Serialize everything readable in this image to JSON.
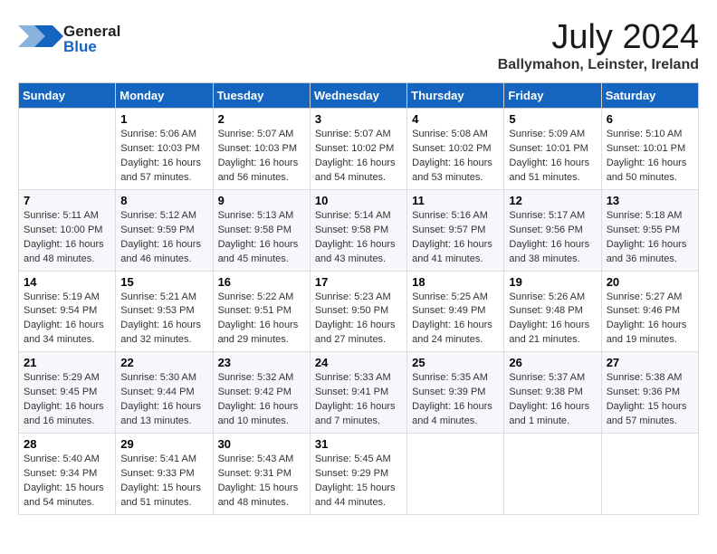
{
  "logo": {
    "general": "General",
    "blue": "Blue"
  },
  "title": "July 2024",
  "subtitle": "Ballymahon, Leinster, Ireland",
  "headers": [
    "Sunday",
    "Monday",
    "Tuesday",
    "Wednesday",
    "Thursday",
    "Friday",
    "Saturday"
  ],
  "weeks": [
    [
      {
        "day": "",
        "info": ""
      },
      {
        "day": "1",
        "info": "Sunrise: 5:06 AM\nSunset: 10:03 PM\nDaylight: 16 hours\nand 57 minutes."
      },
      {
        "day": "2",
        "info": "Sunrise: 5:07 AM\nSunset: 10:03 PM\nDaylight: 16 hours\nand 56 minutes."
      },
      {
        "day": "3",
        "info": "Sunrise: 5:07 AM\nSunset: 10:02 PM\nDaylight: 16 hours\nand 54 minutes."
      },
      {
        "day": "4",
        "info": "Sunrise: 5:08 AM\nSunset: 10:02 PM\nDaylight: 16 hours\nand 53 minutes."
      },
      {
        "day": "5",
        "info": "Sunrise: 5:09 AM\nSunset: 10:01 PM\nDaylight: 16 hours\nand 51 minutes."
      },
      {
        "day": "6",
        "info": "Sunrise: 5:10 AM\nSunset: 10:01 PM\nDaylight: 16 hours\nand 50 minutes."
      }
    ],
    [
      {
        "day": "7",
        "info": "Sunrise: 5:11 AM\nSunset: 10:00 PM\nDaylight: 16 hours\nand 48 minutes."
      },
      {
        "day": "8",
        "info": "Sunrise: 5:12 AM\nSunset: 9:59 PM\nDaylight: 16 hours\nand 46 minutes."
      },
      {
        "day": "9",
        "info": "Sunrise: 5:13 AM\nSunset: 9:58 PM\nDaylight: 16 hours\nand 45 minutes."
      },
      {
        "day": "10",
        "info": "Sunrise: 5:14 AM\nSunset: 9:58 PM\nDaylight: 16 hours\nand 43 minutes."
      },
      {
        "day": "11",
        "info": "Sunrise: 5:16 AM\nSunset: 9:57 PM\nDaylight: 16 hours\nand 41 minutes."
      },
      {
        "day": "12",
        "info": "Sunrise: 5:17 AM\nSunset: 9:56 PM\nDaylight: 16 hours\nand 38 minutes."
      },
      {
        "day": "13",
        "info": "Sunrise: 5:18 AM\nSunset: 9:55 PM\nDaylight: 16 hours\nand 36 minutes."
      }
    ],
    [
      {
        "day": "14",
        "info": "Sunrise: 5:19 AM\nSunset: 9:54 PM\nDaylight: 16 hours\nand 34 minutes."
      },
      {
        "day": "15",
        "info": "Sunrise: 5:21 AM\nSunset: 9:53 PM\nDaylight: 16 hours\nand 32 minutes."
      },
      {
        "day": "16",
        "info": "Sunrise: 5:22 AM\nSunset: 9:51 PM\nDaylight: 16 hours\nand 29 minutes."
      },
      {
        "day": "17",
        "info": "Sunrise: 5:23 AM\nSunset: 9:50 PM\nDaylight: 16 hours\nand 27 minutes."
      },
      {
        "day": "18",
        "info": "Sunrise: 5:25 AM\nSunset: 9:49 PM\nDaylight: 16 hours\nand 24 minutes."
      },
      {
        "day": "19",
        "info": "Sunrise: 5:26 AM\nSunset: 9:48 PM\nDaylight: 16 hours\nand 21 minutes."
      },
      {
        "day": "20",
        "info": "Sunrise: 5:27 AM\nSunset: 9:46 PM\nDaylight: 16 hours\nand 19 minutes."
      }
    ],
    [
      {
        "day": "21",
        "info": "Sunrise: 5:29 AM\nSunset: 9:45 PM\nDaylight: 16 hours\nand 16 minutes."
      },
      {
        "day": "22",
        "info": "Sunrise: 5:30 AM\nSunset: 9:44 PM\nDaylight: 16 hours\nand 13 minutes."
      },
      {
        "day": "23",
        "info": "Sunrise: 5:32 AM\nSunset: 9:42 PM\nDaylight: 16 hours\nand 10 minutes."
      },
      {
        "day": "24",
        "info": "Sunrise: 5:33 AM\nSunset: 9:41 PM\nDaylight: 16 hours\nand 7 minutes."
      },
      {
        "day": "25",
        "info": "Sunrise: 5:35 AM\nSunset: 9:39 PM\nDaylight: 16 hours\nand 4 minutes."
      },
      {
        "day": "26",
        "info": "Sunrise: 5:37 AM\nSunset: 9:38 PM\nDaylight: 16 hours\nand 1 minute."
      },
      {
        "day": "27",
        "info": "Sunrise: 5:38 AM\nSunset: 9:36 PM\nDaylight: 15 hours\nand 57 minutes."
      }
    ],
    [
      {
        "day": "28",
        "info": "Sunrise: 5:40 AM\nSunset: 9:34 PM\nDaylight: 15 hours\nand 54 minutes."
      },
      {
        "day": "29",
        "info": "Sunrise: 5:41 AM\nSunset: 9:33 PM\nDaylight: 15 hours\nand 51 minutes."
      },
      {
        "day": "30",
        "info": "Sunrise: 5:43 AM\nSunset: 9:31 PM\nDaylight: 15 hours\nand 48 minutes."
      },
      {
        "day": "31",
        "info": "Sunrise: 5:45 AM\nSunset: 9:29 PM\nDaylight: 15 hours\nand 44 minutes."
      },
      {
        "day": "",
        "info": ""
      },
      {
        "day": "",
        "info": ""
      },
      {
        "day": "",
        "info": ""
      }
    ]
  ]
}
